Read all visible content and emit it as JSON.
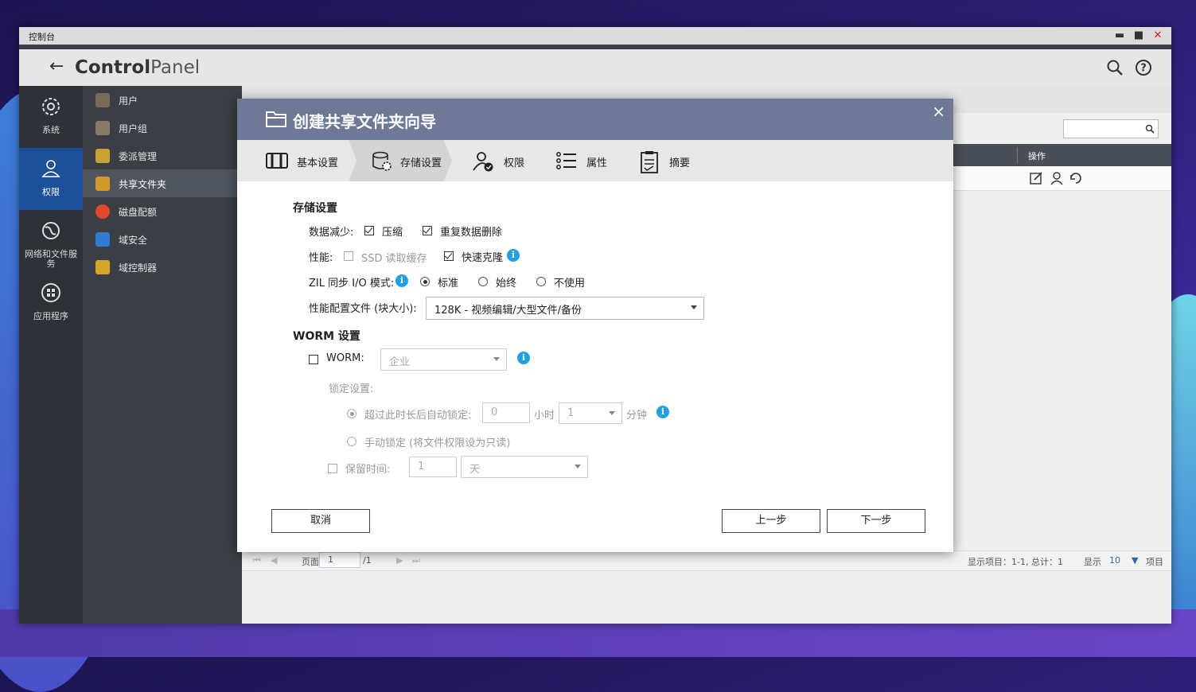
{
  "window": {
    "title": "控制台"
  },
  "header": {
    "brand_bold": "Control",
    "brand_light": "Panel"
  },
  "leftbar": [
    {
      "label": "系统",
      "icon": "gear-icon"
    },
    {
      "label": "权限",
      "icon": "user-icon",
      "active": true
    },
    {
      "label": "网络和文件服务",
      "icon": "globe-icon"
    },
    {
      "label": "应用程序",
      "icon": "apps-icon"
    }
  ],
  "subnav": [
    {
      "label": "用户",
      "color": "#7a6a5a"
    },
    {
      "label": "用户组",
      "color": "#8a7a6a"
    },
    {
      "label": "委派管理",
      "color": "#c9a235"
    },
    {
      "label": "共享文件夹",
      "color": "#d19a2a",
      "active": true
    },
    {
      "label": "磁盘配额",
      "color": "#e2462c"
    },
    {
      "label": "域安全",
      "color": "#2f7cd0"
    },
    {
      "label": "域控制器",
      "color": "#d8a62c"
    }
  ],
  "table": {
    "op_header": "操作"
  },
  "pager": {
    "page_label": "页面",
    "page_value": "1",
    "page_total": "/1",
    "display_info": "显示项目：1-1, 总计：1",
    "show_label": "显示",
    "show_count": "10",
    "items_label": "项目"
  },
  "dialog": {
    "title": "创建共享文件夹向导",
    "steps": [
      {
        "label": "基本设置",
        "icon": "basic-settings-icon"
      },
      {
        "label": "存储设置",
        "icon": "storage-settings-icon",
        "active": true
      },
      {
        "label": "权限",
        "icon": "permission-icon"
      },
      {
        "label": "属性",
        "icon": "properties-icon"
      },
      {
        "label": "摘要",
        "icon": "summary-icon"
      }
    ],
    "storage": {
      "section_title": "存储设置",
      "data_reduction_label": "数据减少:",
      "compress_label": "压缩",
      "dedup_label": "重复数据删除",
      "performance_label": "性能:",
      "ssd_cache_label": "SSD 读取缓存",
      "fast_clone_label": "快速克隆",
      "zil_label": "ZIL 同步 I/O 模式:",
      "zil_options": [
        "标准",
        "始终",
        "不使用"
      ],
      "profile_label": "性能配置文件 (块大小):",
      "profile_value": "128K - 视频编辑/大型文件/备份"
    },
    "worm": {
      "section_title": "WORM 设置",
      "worm_label": "WORM:",
      "worm_type": "企业",
      "lock_settings_label": "锁定设置:",
      "auto_lock_label": "超过此时长后自动锁定:",
      "hours_value": "0",
      "hours_label": "小时",
      "minutes_value": "1",
      "minutes_label": "分钟",
      "manual_lock_label": "手动锁定 (将文件权限设为只读)",
      "retention_label": "保留时间:",
      "retention_value": "1",
      "retention_unit": "天"
    },
    "buttons": {
      "cancel": "取消",
      "prev": "上一步",
      "next": "下一步"
    }
  }
}
